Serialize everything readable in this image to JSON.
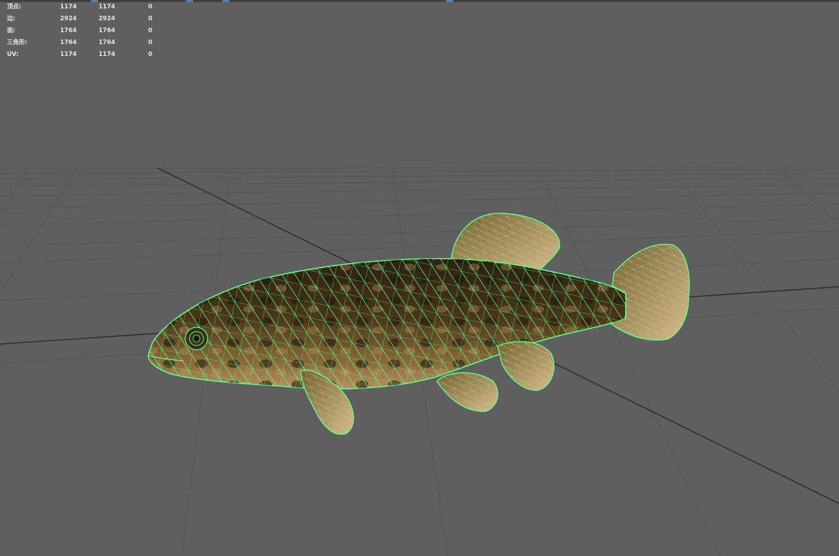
{
  "hud": {
    "rows": [
      {
        "label": "顶点:",
        "v1": "1174",
        "v2": "1174",
        "v3": "0"
      },
      {
        "label": "边:",
        "v1": "2924",
        "v2": "2924",
        "v3": "0"
      },
      {
        "label": "面:",
        "v1": "1764",
        "v2": "1764",
        "v3": "0"
      },
      {
        "label": "三角形:",
        "v1": "1764",
        "v2": "1764",
        "v3": "0"
      },
      {
        "label": "UV:",
        "v1": "1174",
        "v2": "1174",
        "v3": "0"
      }
    ]
  },
  "colors": {
    "background": "#5f5f5f",
    "grid_line": "#505050",
    "grid_axis": "#2e2e2e",
    "wireframe": "#5dff8a",
    "body_dark": "#3a2a12",
    "body_light": "#a07a45",
    "fin": "#d9a873"
  },
  "object": {
    "name": "fish-model",
    "display_mode": "wireframe-on-shaded"
  }
}
